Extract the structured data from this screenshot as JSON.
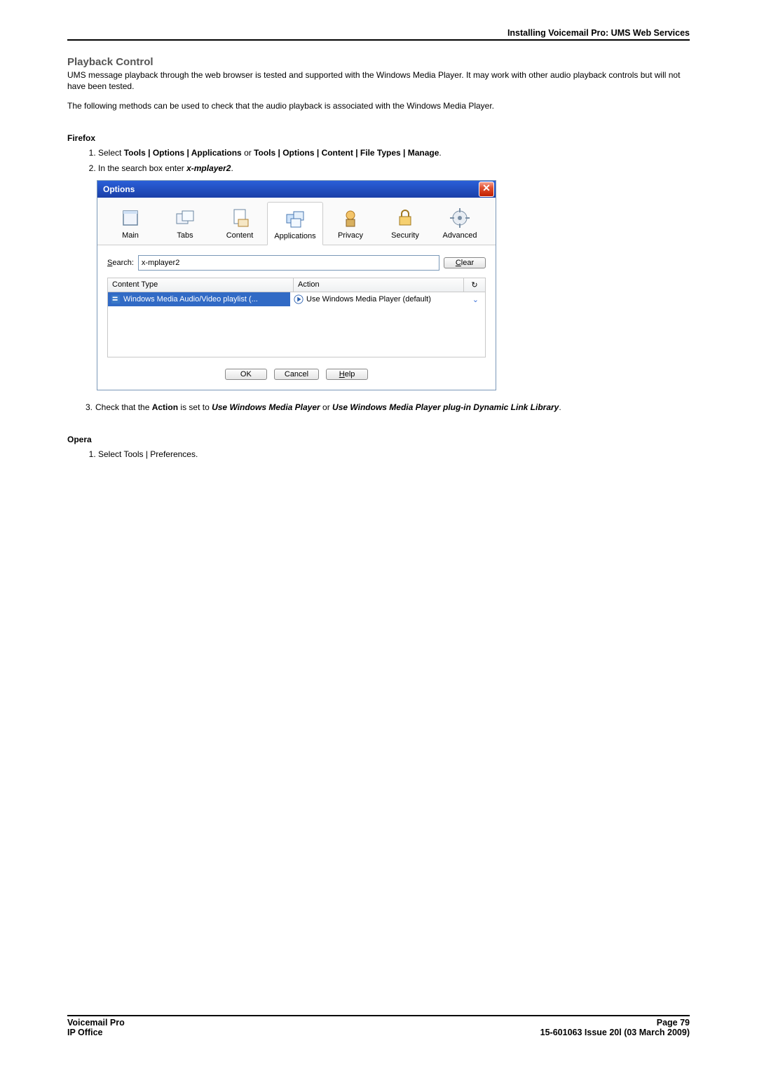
{
  "header": {
    "crumb": "Installing Voicemail Pro: UMS Web Services"
  },
  "section": {
    "title": "Playback Control",
    "p1": "UMS message playback through the web browser is tested and supported with the Windows Media Player. It may work with other audio playback controls but will not have been tested.",
    "p2": "The following methods can be used to check that the audio playback is associated with the Windows Media Player."
  },
  "firefox": {
    "heading": "Firefox",
    "step1_pre": "Select ",
    "step1_bold1": "Tools | Options | Applications",
    "step1_mid": " or ",
    "step1_bold2": "Tools | Options | Content | File Types | Manage",
    "step1_post": ".",
    "step2_pre": "In the search box enter ",
    "step2_bolditalic": "x-mplayer2",
    "step2_post": ".",
    "step3_pre": "Check that the ",
    "step3_b1": "Action",
    "step3_mid1": " is set to ",
    "step3_bi1": "Use Windows Media Player",
    "step3_mid2": " or ",
    "step3_bi2": "Use Windows Media Player plug-in Dynamic Link Library",
    "step3_post": "."
  },
  "dialog": {
    "title": "Options",
    "tabs": {
      "main": "Main",
      "tabs": "Tabs",
      "content": "Content",
      "applications": "Applications",
      "privacy": "Privacy",
      "security": "Security",
      "advanced": "Advanced"
    },
    "search_label_pre": "S",
    "search_label_rest": "earch:",
    "search_value": "x-mplayer2",
    "clear_label_pre": "C",
    "clear_label_rest": "lear",
    "col_content_type": "Content Type",
    "col_action": "Action",
    "row_type": "Windows Media Audio/Video playlist (...",
    "row_action": "Use Windows Media Player (default)",
    "ok": "OK",
    "cancel": "Cancel",
    "help_pre": "H",
    "help_rest": "elp"
  },
  "opera": {
    "heading": "Opera",
    "step1": "Select Tools | Preferences."
  },
  "footer": {
    "left1": "Voicemail Pro",
    "left2": "IP Office",
    "right1": "Page 79",
    "right2": "15-601063 Issue 20l (03 March 2009)"
  }
}
